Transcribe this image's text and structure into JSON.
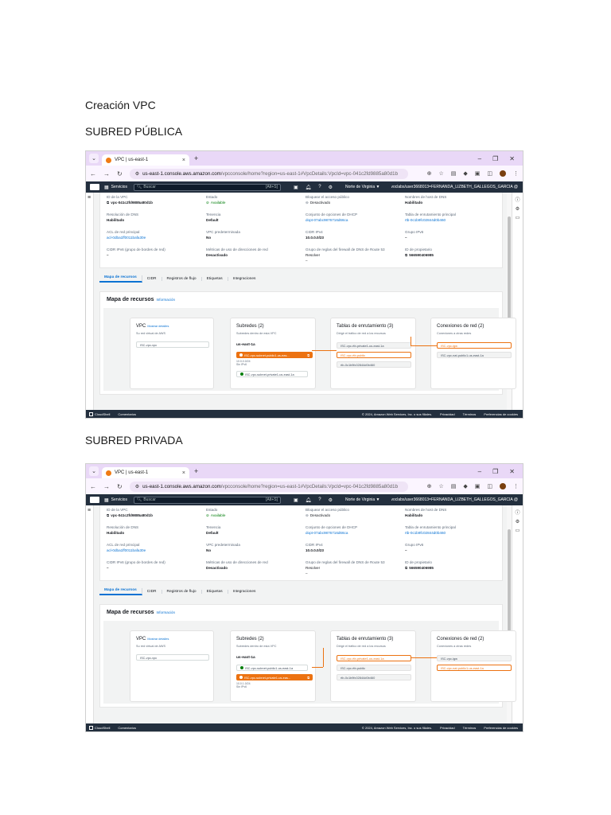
{
  "document": {
    "title": "Creación VPC",
    "section_public": "SUBRED PÚBLICA",
    "section_private": "SUBRED PRIVADA"
  },
  "screenshots": [
    {
      "browser": {
        "tab_title": "VPC | us-east-1",
        "url_host": "us-east-1.console.aws.amazon.com",
        "url_path": "/vpcconsole/home?region=us-east-1#VpcDetails:VpcId=vpc-041c2fd9885a80d1b"
      },
      "aws_nav": {
        "services": "Servicios",
        "search_placeholder": "Buscar",
        "search_kbd": "[Alt+S]",
        "region": "Norte de Virginia ▼",
        "account": "voclabs/user3668013=FERNANDA_LIZBETH_GALLEGOS_GARCIA @ 5665-0..."
      },
      "details": {
        "vpc_id_label": "ID de la VPC",
        "vpc_id_value": "vpc-041c2fd9885a80d1b",
        "state_label": "Estado",
        "state_value": "Available",
        "block_label": "Bloquear el acceso público",
        "block_value": "Desactivado",
        "dns_host_label": "Nombres de host de DNS",
        "dns_host_value": "Habilitado",
        "dns_res_label": "Resolución de DNS",
        "dns_res_value": "Habilitado",
        "tenancy_label": "Tenencia",
        "tenancy_value": "Default",
        "dhcp_label": "Conjunto de opciones de DHCP",
        "dhcp_value": "dopt-07abc9876716d66ca",
        "rtb_label": "Tabla de enrutamiento principal",
        "rtb_value": "rtb-0c1b9fc02844d0b460",
        "acl_label": "ACL de red principal",
        "acl_value": "acl-0dba1ff0011bafa30e",
        "default_vpc_label": "VPC predeterminada",
        "default_vpc_value": "No",
        "cidr4_label": "CIDR IPv4",
        "cidr4_value": "10.0.0.0/23",
        "ipv6_pool_label": "Grupo IPv6",
        "ipv6_pool_value": "–",
        "ipv6_cidr_label": "CIDR IPv6 (grupo de bordes de red)",
        "ipv6_cidr_value": "–",
        "metrics_label": "Métricas de uso de direcciones de red",
        "metrics_value": "Desactivado",
        "r53_label": "Grupo de reglas del firewall de DNS de Route 53",
        "r53_value": "Resolver",
        "r53_value2": "–",
        "owner_label": "ID de propietario",
        "owner_value": "566590406985"
      },
      "tabs": [
        "Mapa de recursos",
        "CIDR",
        "Registros de flujo",
        "Etiquetas",
        "Integraciones"
      ],
      "map": {
        "title": "Mapa de recursos",
        "info": "Información",
        "vpc_title": "VPC",
        "vpc_info": "Mostrar detalles",
        "vpc_sub": "Su red virtual de AWS",
        "vpc_name": "ISC-vpc-vpc",
        "subnets_title": "Subredes (2)",
        "subnets_sub": "Subredes dentro de esta VPC",
        "az": "us-east-1a",
        "subnet_selected": "ISC-vpc-subnet-public1-us-eas...",
        "subnet_other": "ISC-vpc-subnet-private1-us-east-1a",
        "subnet_cidr": "10.0.0.0/24",
        "subnet_ipv6": "Sin IPv6",
        "rt_title": "Tablas de enrutamiento (3)",
        "rt_sub": "Dirigir el tráfico de red a los recursos",
        "rt_1": "ISC-vpc-rtb-private1-us-east-1a",
        "rt_2": "ISC-vpc-rtb-public",
        "rt_3": "rtb-0c1b9fc02844d0b460",
        "conn_title": "Conexiones de red (2)",
        "conn_sub": "Conexiones a otras redes",
        "conn_1": "ISC-vpc-igw",
        "conn_2": "ISC-vpc-nat-public1-us-east-1a"
      },
      "footer": {
        "cloudshell": "CloudShell",
        "feedback": "Comentarios",
        "copyright": "© 2024, Amazon Web Services, Inc. o sus filiales.",
        "privacy": "Privacidad",
        "terms": "Términos",
        "cookies": "Preferencias de cookies"
      }
    },
    {
      "browser": {
        "tab_title": "VPC | us-east-1",
        "url_host": "us-east-1.console.aws.amazon.com",
        "url_path": "/vpcconsole/home?region=us-east-1#VpcDetails:VpcId=vpc-041c2fd9885a80d1b"
      },
      "aws_nav": {
        "services": "Servicios",
        "search_placeholder": "Buscar",
        "search_kbd": "[Alt+S]",
        "region": "Norte de Virginia ▼",
        "account": "voclabs/user3668013=FERNANDA_LIZBETH_GALLEGOS_GARCIA @ 5665-0..."
      },
      "details": {
        "vpc_id_label": "ID de la VPC",
        "vpc_id_value": "vpc-041c2fd9885a80d1b",
        "state_label": "Estado",
        "state_value": "Available",
        "block_label": "Bloquear el acceso público",
        "block_value": "Desactivado",
        "dns_host_label": "Nombres de host de DNS",
        "dns_host_value": "Habilitado",
        "dns_res_label": "Resolución de DNS",
        "dns_res_value": "Habilitado",
        "tenancy_label": "Tenencia",
        "tenancy_value": "Default",
        "dhcp_label": "Conjunto de opciones de DHCP",
        "dhcp_value": "dopt-07abc9876716d66ca",
        "rtb_label": "Tabla de enrutamiento principal",
        "rtb_value": "rtb-0c1b9fc02844d0b460",
        "acl_label": "ACL de red principal",
        "acl_value": "acl-0dba1ff0011bafa30e",
        "default_vpc_label": "VPC predeterminada",
        "default_vpc_value": "No",
        "cidr4_label": "CIDR IPv4",
        "cidr4_value": "10.0.0.0/23",
        "ipv6_pool_label": "Grupo IPv6",
        "ipv6_pool_value": "–",
        "ipv6_cidr_label": "CIDR IPv6 (grupo de bordes de red)",
        "ipv6_cidr_value": "–",
        "metrics_label": "Métricas de uso de direcciones de red",
        "metrics_value": "Desactivado",
        "r53_label": "Grupo de reglas del firewall de DNS de Route 53",
        "r53_value": "Resolver",
        "r53_value2": "–",
        "owner_label": "ID de propietario",
        "owner_value": "566590406985"
      },
      "tabs": [
        "Mapa de recursos",
        "CIDR",
        "Registros de flujo",
        "Etiquetas",
        "Integraciones"
      ],
      "map": {
        "title": "Mapa de recursos",
        "info": "Información",
        "vpc_title": "VPC",
        "vpc_info": "Mostrar detalles",
        "vpc_sub": "Su red virtual de AWS",
        "vpc_name": "ISC-vpc-vpc",
        "subnets_title": "Subredes (2)",
        "subnets_sub": "Subredes dentro de esta VPC",
        "az": "us-east-1a",
        "subnet_selected": "ISC-vpc-subnet-private1-us-eas...",
        "subnet_other": "ISC-vpc-subnet-public1-us-east-1a",
        "subnet_cidr": "10.0.1.0/24",
        "subnet_ipv6": "Sin IPv6",
        "rt_title": "Tablas de enrutamiento (3)",
        "rt_sub": "Dirigir el tráfico de red a los recursos",
        "rt_1": "ISC-vpc-rtb-private1-us-east-1a",
        "rt_2": "ISC-vpc-rtb-public",
        "rt_3": "rtb-0c1b9fc02844d0b460",
        "conn_title": "Conexiones de red (2)",
        "conn_sub": "Conexiones a otras redes",
        "conn_1": "ISC-vpc-igw",
        "conn_2": "ISC-vpc-nat-public1-us-east-1a"
      },
      "footer": {
        "cloudshell": "CloudShell",
        "feedback": "Comentarios",
        "copyright": "© 2024, Amazon Web Services, Inc. o sus filiales.",
        "privacy": "Privacidad",
        "terms": "Términos",
        "cookies": "Preferencias de cookies"
      }
    }
  ]
}
